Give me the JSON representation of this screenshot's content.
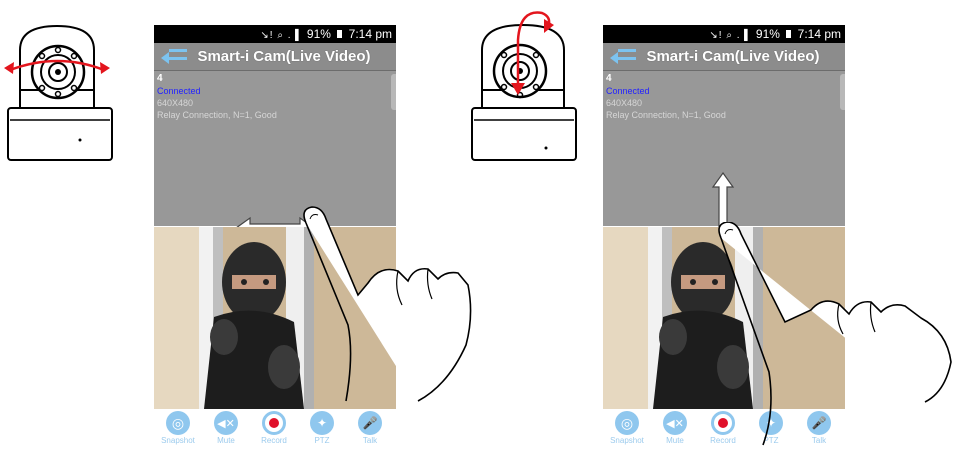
{
  "panels": [
    {
      "status": {
        "battery": "91%",
        "time": "7:14 pm"
      },
      "title": "Smart-i Cam(Live Video)",
      "info": {
        "channel": "4",
        "state": "Connected",
        "resolution": "640X480",
        "relay": "Relay Connection, N=1, Good"
      },
      "toolbar": [
        {
          "label": "Snapshot",
          "icon": "camera-shutter-icon"
        },
        {
          "label": "Mute",
          "icon": "speaker-mute-icon"
        },
        {
          "label": "Record",
          "icon": "record-icon"
        },
        {
          "label": "PTZ",
          "icon": "ptz-icon"
        },
        {
          "label": "Talk",
          "icon": "microphone-icon"
        }
      ],
      "gesture": "swipe-horizontal"
    },
    {
      "status": {
        "battery": "91%",
        "time": "7:14 pm"
      },
      "title": "Smart-i Cam(Live Video)",
      "info": {
        "channel": "4",
        "state": "Connected",
        "resolution": "640X480",
        "relay": "Relay Connection, N=1, Good"
      },
      "toolbar": [
        {
          "label": "Snapshot",
          "icon": "camera-shutter-icon"
        },
        {
          "label": "Mute",
          "icon": "speaker-mute-icon"
        },
        {
          "label": "Record",
          "icon": "record-icon"
        },
        {
          "label": "PTZ",
          "icon": "ptz-icon"
        },
        {
          "label": "Talk",
          "icon": "microphone-icon"
        }
      ],
      "gesture": "swipe-vertical"
    }
  ],
  "colors": {
    "titlebar": "#8c8c8c",
    "connected": "#2222ff",
    "toolbar_icon": "#8fc7ee",
    "record": "#e0102a",
    "arrow_red": "#e3151d"
  }
}
